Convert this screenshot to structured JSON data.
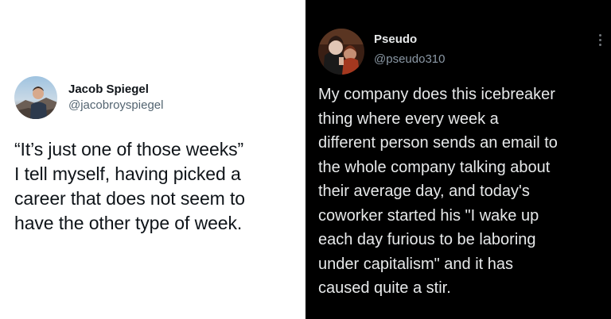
{
  "left_tweet": {
    "display_name": "Jacob Spiegel",
    "handle": "@jacobroyspiegel",
    "text_lines": [
      "“It’s just one of those weeks”",
      "I tell myself, having picked a",
      "career that does not seem to",
      "have the other type of week."
    ],
    "theme": "light",
    "background_color": "#ffffff",
    "avatar_icon": "user-avatar-photo"
  },
  "right_tweet": {
    "display_name": "Pseudo",
    "handle": "@pseudo310",
    "text_lines": [
      "My company does this icebreaker",
      "thing where every week a",
      "different person sends an email to",
      "the whole company talking about",
      "their average day, and today's",
      "coworker started his \"I wake up",
      "each day furious to be laboring",
      "under capitalism\" and it has",
      "caused quite a stir."
    ],
    "theme": "dark",
    "background_color": "#000000",
    "avatar_icon": "user-avatar-photo",
    "more_icon": "more-options-icon"
  }
}
